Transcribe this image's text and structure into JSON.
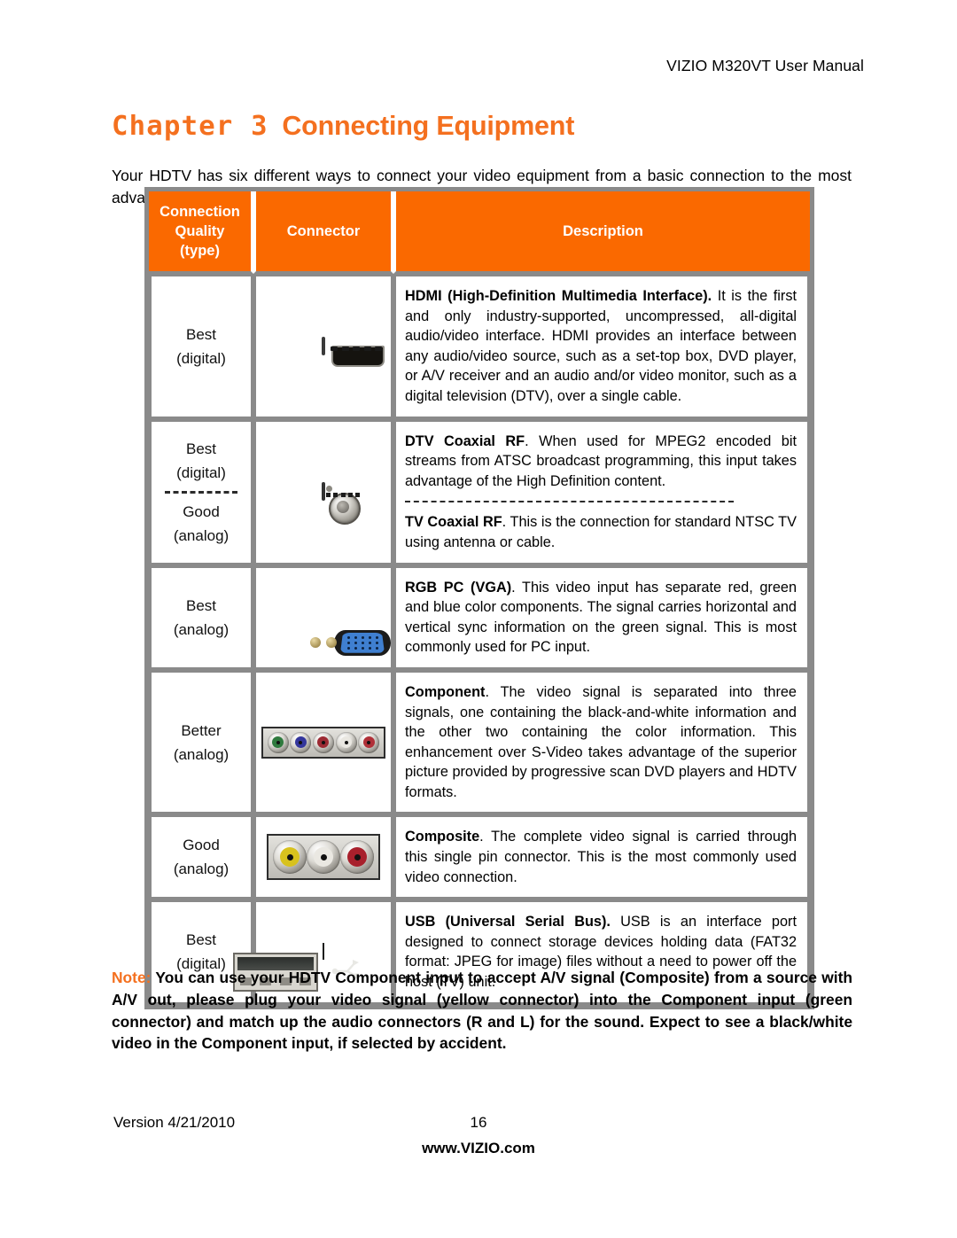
{
  "document": {
    "running_header": "VIZIO M320VT User Manual",
    "chapter_label": "Chapter 3",
    "chapter_title": "Connecting Equipment",
    "intro": "Your HDTV has six different ways to connect your video equipment from a basic connection to the most advanced for digital signals."
  },
  "table": {
    "headers": {
      "quality": "Connection Quality (type)",
      "quality_line1": "Connection",
      "quality_line2": "Quality",
      "quality_line3": "(type)",
      "connector": "Connector",
      "description": "Description"
    },
    "rows": [
      {
        "quality_lines": [
          "Best",
          "(digital)"
        ],
        "has_quality_divider": false,
        "connector_icon": "hdmi-port-icon",
        "desc_blocks": [
          {
            "title": "HDMI (High-Definition Multimedia Interface).",
            "body": " It is the first and only industry-supported, uncompressed, all-digital audio/video interface. HDMI provides an interface between any audio/video source, such as a set-top box, DVD player, or A/V receiver and an audio and/or video monitor, such as a digital television (DTV), over a single cable."
          }
        ]
      },
      {
        "quality_lines": [
          "Best",
          "(digital)"
        ],
        "quality_lines_2": [
          "Good",
          "(analog)"
        ],
        "has_quality_divider": true,
        "connector_icon": "coaxial-rf-jack-icon",
        "desc_blocks": [
          {
            "title": "DTV Coaxial RF",
            "body": ".  When used for MPEG2 encoded bit streams from ATSC broadcast programming, this input takes advantage of the High Definition content."
          },
          {
            "title": "TV Coaxial RF",
            "body": ". This is the connection for standard NTSC TV using antenna or cable."
          }
        ]
      },
      {
        "quality_lines": [
          "Best",
          "(analog)"
        ],
        "has_quality_divider": false,
        "connector_icon": "vga-d-sub-connector-icon",
        "desc_blocks": [
          {
            "title": "RGB PC (VGA)",
            "body": ". This video input has separate red, green and blue color components.   The signal carries horizontal and vertical sync information on the green signal.   This is most commonly used for PC input."
          }
        ]
      },
      {
        "quality_lines": [
          "Better",
          "(analog)"
        ],
        "has_quality_divider": false,
        "connector_icon": "component-rca-jacks-icon",
        "desc_blocks": [
          {
            "title": "Component",
            "body": ". The video signal is separated into three signals, one containing the black-and-white information and the other two containing the color information. This enhancement over S-Video takes advantage of the superior picture provided by progressive scan DVD players and HDTV formats."
          }
        ]
      },
      {
        "quality_lines": [
          "Good",
          "(analog)"
        ],
        "has_quality_divider": false,
        "connector_icon": "composite-rca-jacks-icon",
        "desc_blocks": [
          {
            "title": "Composite",
            "body": ". The complete video signal is carried through this single pin connector. This is the most commonly used video connection."
          }
        ]
      },
      {
        "quality_lines": [
          "Best",
          "(digital)"
        ],
        "has_quality_divider": false,
        "connector_icon": "usb-port-icon",
        "desc_blocks": [
          {
            "title": "USB (Universal Serial Bus).",
            "body": " USB is an interface port designed to connect storage devices holding data (FAT32 format: JPEG for image) files without a need to power off the host (TV) unit."
          }
        ]
      }
    ]
  },
  "note": {
    "label": "Note:",
    "text": "  You can use your HDTV Component input to accept A/V signal (Composite) from a source with A/V out, please plug your video signal (yellow connector) into the Component input (green connector) and match up the audio connectors (R and L) for the sound. Expect to see a black/white video in the Component input, if selected by accident."
  },
  "footer": {
    "version": "Version 4/21/2010",
    "page_number": "16",
    "website": "www.VIZIO.com"
  },
  "colors": {
    "accent_orange": "#F4701F",
    "header_orange": "#FA6900",
    "table_border_gray": "#8A8A8A"
  }
}
